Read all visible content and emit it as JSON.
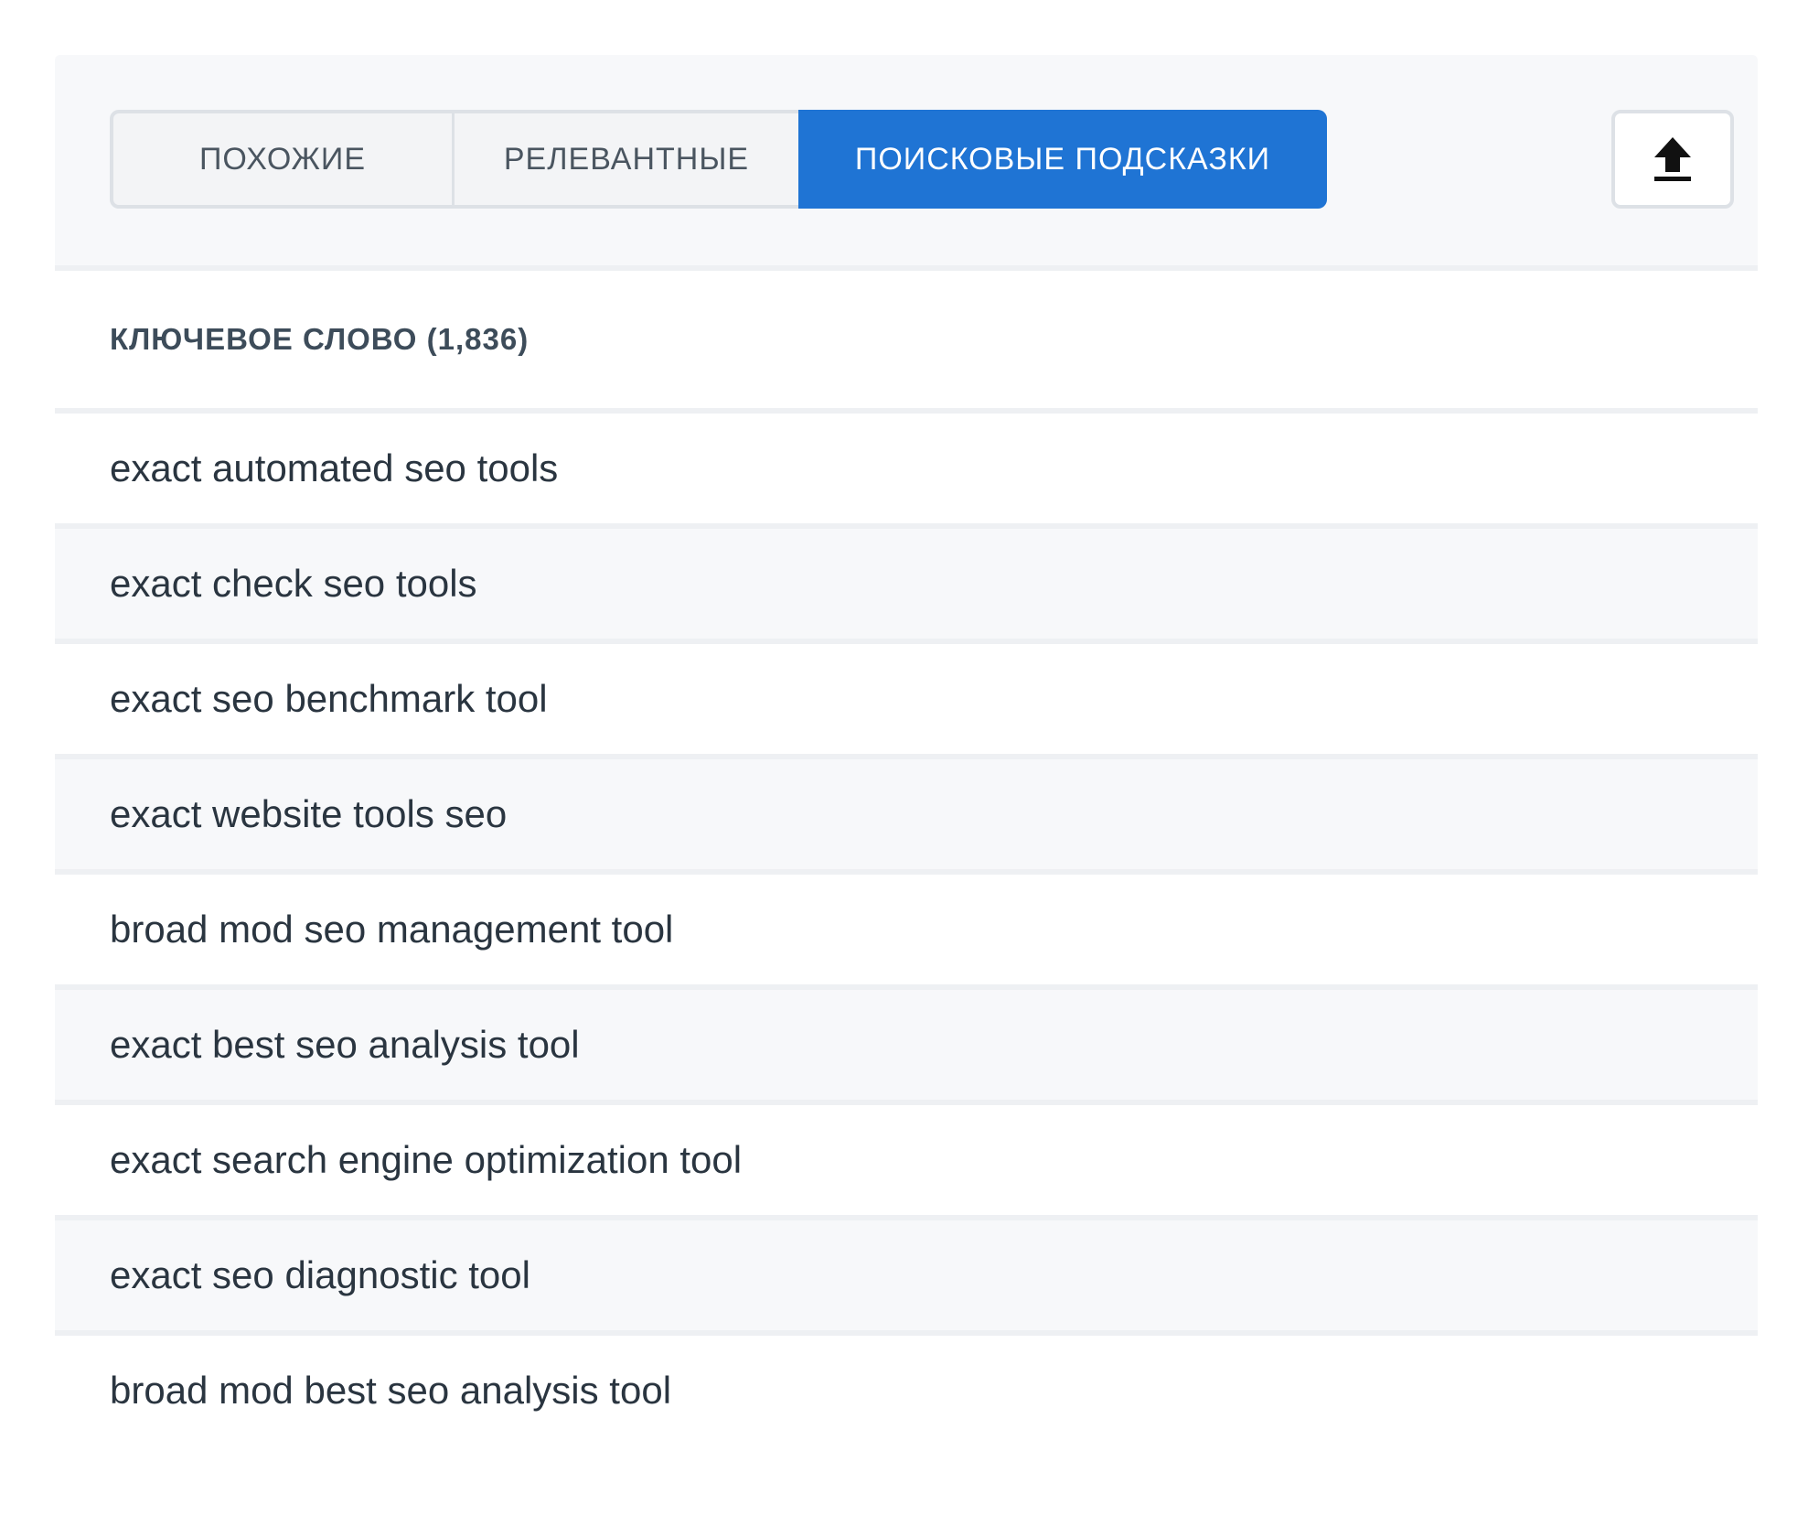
{
  "tabs": [
    {
      "label": "ПОХОЖИЕ",
      "active": false
    },
    {
      "label": "РЕЛЕВАНТНЫЕ",
      "active": false
    },
    {
      "label": "ПОИСКОВЫЕ ПОДСКАЗКИ",
      "active": true
    }
  ],
  "export_icon": "upload-icon",
  "table": {
    "header": "КЛЮЧЕВОЕ СЛОВО",
    "count": "(1,836)",
    "rows": [
      "exact automated seo tools",
      "exact check seo tools",
      "exact seo benchmark tool",
      "exact website tools seo",
      "broad mod seo management tool",
      "exact best seo analysis tool",
      "exact search engine optimization tool",
      "exact seo diagnostic tool",
      "broad mod best seo analysis tool"
    ]
  },
  "colors": {
    "accent": "#1f74d4",
    "panel_bg": "#f7f8fa",
    "border": "#dde1e6"
  }
}
